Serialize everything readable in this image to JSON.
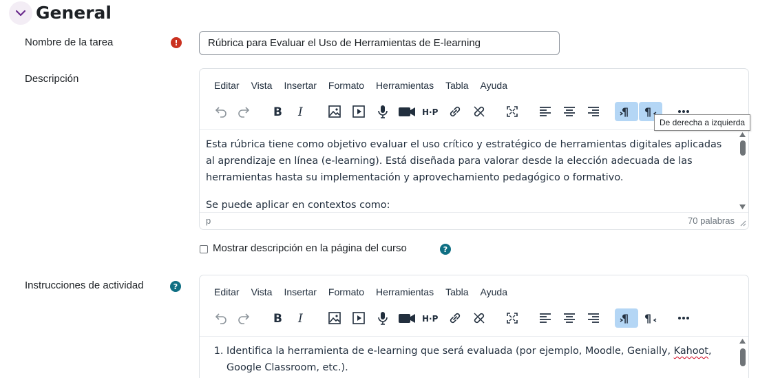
{
  "section": {
    "title": "General",
    "toggle_icon": "chevron-down-icon"
  },
  "task_name": {
    "label": "Nombre de la tarea",
    "required_icon": "exclamation-circle-icon",
    "value": "Rúbrica para Evaluar el Uso de Herramientas de E-learning"
  },
  "editor_menu": [
    "Editar",
    "Vista",
    "Insertar",
    "Formato",
    "Herramientas",
    "Tabla",
    "Ayuda"
  ],
  "toolbar_icons": [
    "undo-icon",
    "redo-icon",
    "bold-icon",
    "italic-icon",
    "image-icon",
    "media-icon",
    "record-audio-icon",
    "record-video-icon",
    "h5p-icon",
    "link-icon",
    "unlink-icon",
    "fullscreen-icon",
    "align-left-icon",
    "align-center-icon",
    "align-right-icon",
    "ltr-icon",
    "rtl-icon",
    "more-icon"
  ],
  "description": {
    "label": "Descripción",
    "paragraph1": "Esta rúbrica tiene como objetivo evaluar el uso crítico y estratégico de herramientas digitales aplicadas al aprendizaje en línea (e-learning). Está diseñada para valorar desde la elección adecuada de las herramientas hasta su implementación y aprovechamiento pedagógico o formativo.",
    "paragraph2": "Se puede aplicar en contextos como:",
    "status_path": "p",
    "word_count": "70 palabras",
    "tooltip": "De derecha a izquierda"
  },
  "show_description": {
    "label": "Mostrar descripción en la página del curso",
    "checked": false
  },
  "activity_instructions": {
    "label": "Instrucciones de actividad",
    "item1_before": "Identifica la herramienta de e-learning que será evaluada (por ejemplo, Moodle, Genially, ",
    "item1_misspelled": "Kahoot",
    "item1_after": ",",
    "item1_line2": "Google Classroom, etc.)."
  },
  "colors": {
    "required": "#ca3120",
    "help": "#0f6f83",
    "active_button": "#b4d6f5",
    "toggle_bg": "#f3edf5"
  }
}
